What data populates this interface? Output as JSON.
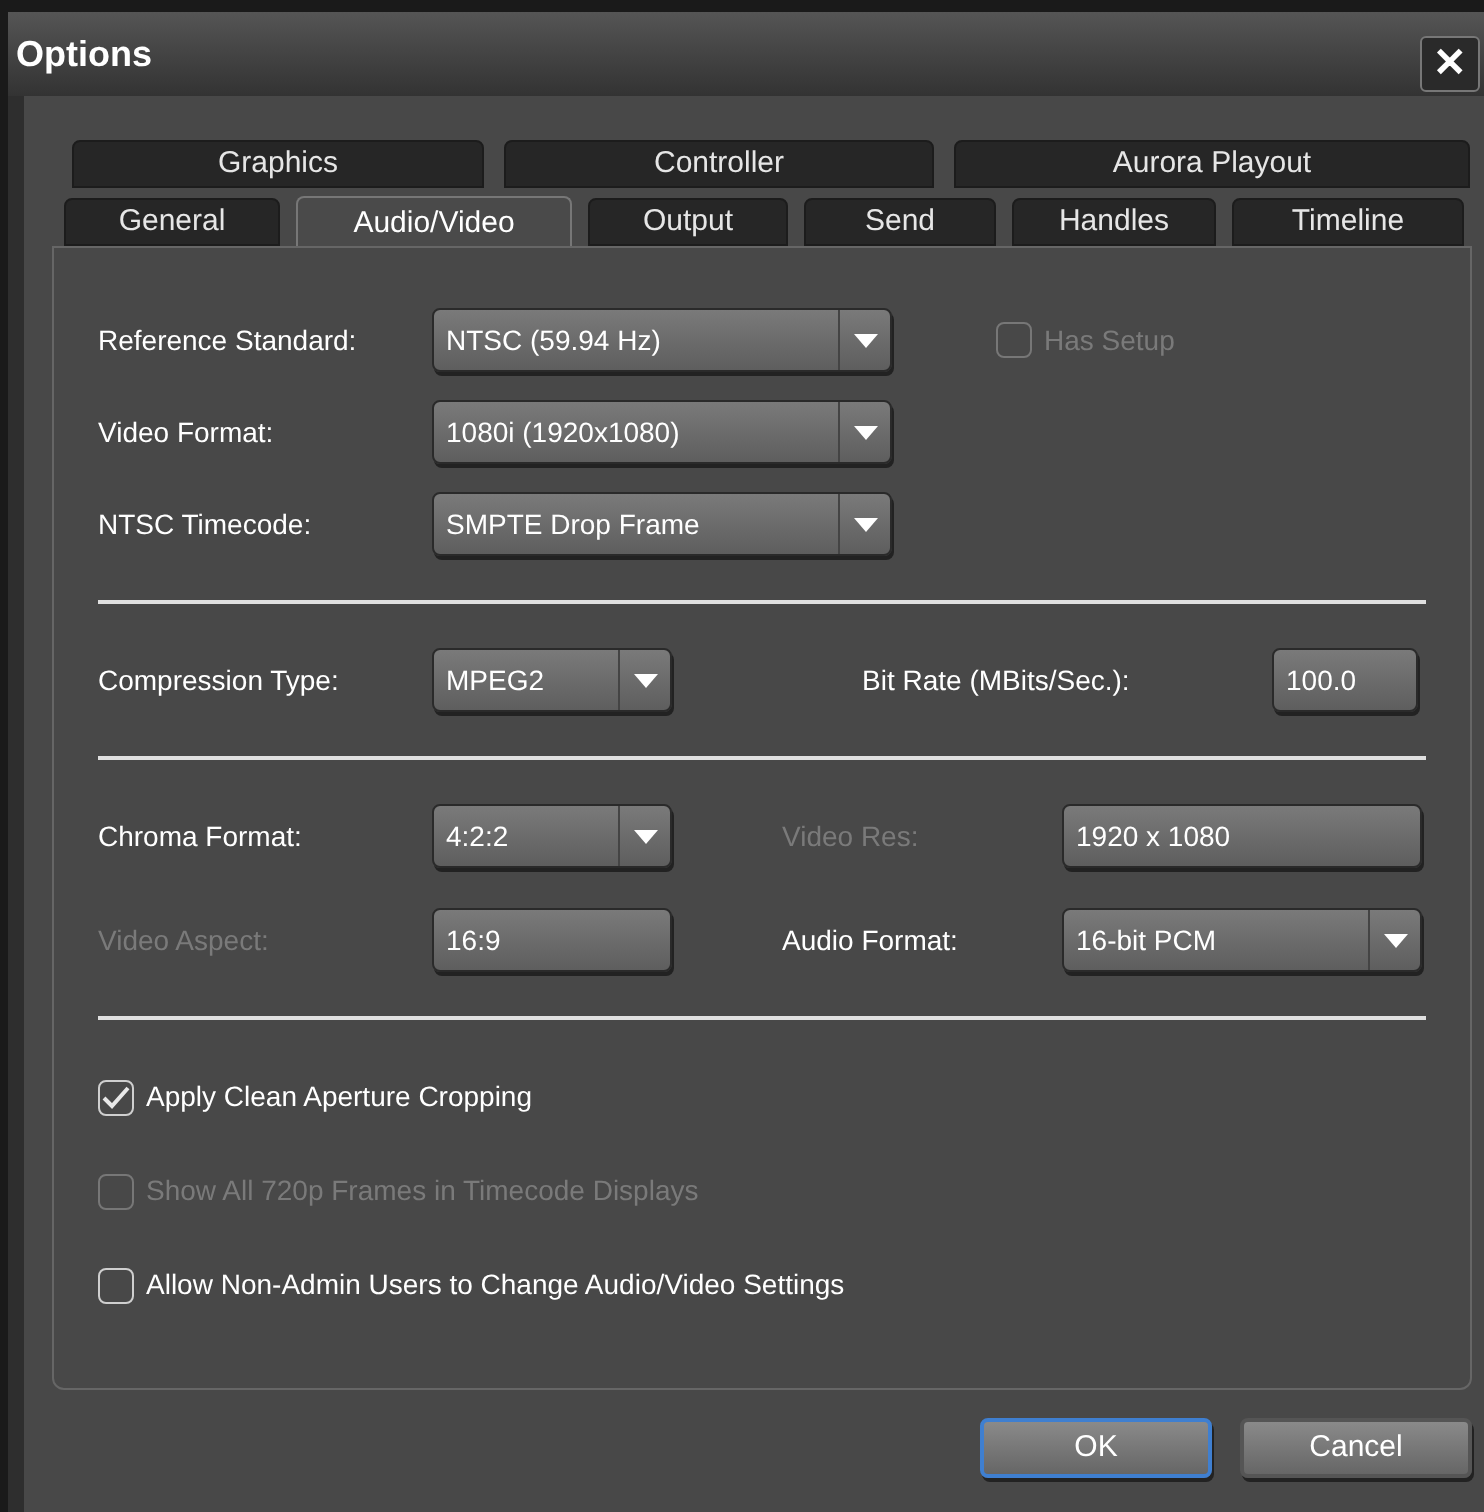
{
  "window": {
    "title": "Options",
    "close": "✕"
  },
  "tabs_back": [
    {
      "label": "Graphics",
      "selected": false
    },
    {
      "label": "Controller",
      "selected": false
    },
    {
      "label": "Aurora Playout",
      "selected": false
    }
  ],
  "tabs_front": [
    {
      "label": "General",
      "selected": false
    },
    {
      "label": "Audio/Video",
      "selected": true
    },
    {
      "label": "Output",
      "selected": false
    },
    {
      "label": "Send",
      "selected": false
    },
    {
      "label": "Handles",
      "selected": false
    },
    {
      "label": "Timeline",
      "selected": false
    }
  ],
  "video_settings": [
    {
      "label": "Reference Standard:",
      "disabled": false,
      "kind": "dropdown",
      "value": "NTSC (59.94 Hz)"
    },
    {
      "label": "Video Format:",
      "disabled": false,
      "kind": "dropdown",
      "value": "1080i (1920x1080)"
    },
    {
      "label": "NTSC Timecode:",
      "disabled": false,
      "kind": "dropdown",
      "value": "SMPTE Drop Frame"
    }
  ],
  "has_setup": {
    "label": "Has Setup",
    "checked": false,
    "disabled": true
  },
  "compression": {
    "label": "Compression Type:",
    "disabled": false,
    "kind": "dropdown",
    "value": "MPEG2"
  },
  "bit_rate": {
    "label": "Bit Rate (MBits/Sec.):",
    "disabled": false,
    "kind": "text",
    "value": "100.0"
  },
  "chroma_format": {
    "label": "Chroma Format:",
    "disabled": false,
    "kind": "dropdown",
    "value": "4:2:2"
  },
  "video_res": {
    "label": "Video Res:",
    "disabled": true,
    "kind": "text",
    "value": "1920 x 1080"
  },
  "video_aspect": {
    "label": "Video Aspect:",
    "disabled": true,
    "kind": "text",
    "value": "16:9"
  },
  "audio_format": {
    "label": "Audio Format:",
    "disabled": false,
    "kind": "dropdown",
    "value": "16-bit PCM"
  },
  "options": [
    {
      "label": "Apply Clean Aperture Cropping",
      "checked": true,
      "disabled": false
    },
    {
      "label": "Show All 720p Frames in Timecode Displays",
      "checked": false,
      "disabled": true
    },
    {
      "label": "Allow Non-Admin Users to Change Audio/Video Settings",
      "checked": false,
      "disabled": false
    }
  ],
  "buttons": [
    {
      "label": "OK",
      "focused": true
    },
    {
      "label": "Cancel",
      "focused": false
    }
  ]
}
